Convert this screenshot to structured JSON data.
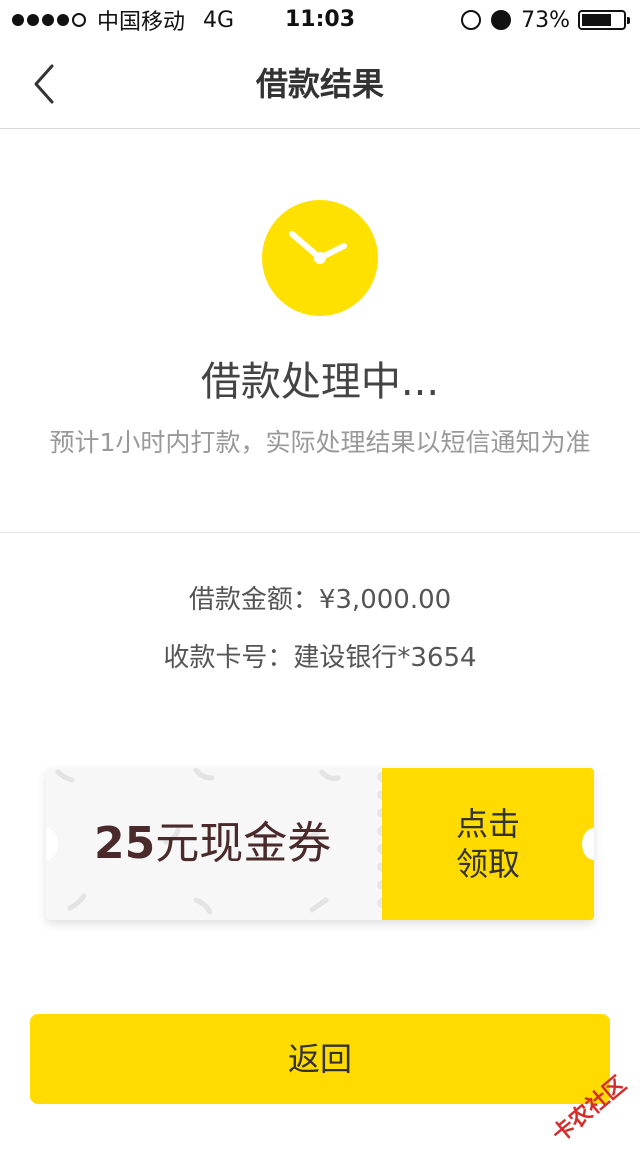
{
  "status_bar": {
    "carrier": "中国移动",
    "network": "4G",
    "time": "11:03",
    "battery": "73%",
    "battery_level": 0.73
  },
  "nav": {
    "title": "借款结果",
    "back_icon": "chevron-left-icon"
  },
  "status": {
    "icon": "clock-icon",
    "icon_color": "#ffe100",
    "title": "借款处理中...",
    "description": "预计1小时内打款，实际处理结果以短信通知为准"
  },
  "loan": {
    "amount_label": "借款金额：",
    "amount_value": "¥3,000.00",
    "card_label": "收款卡号：",
    "card_value": "建设银行*3654"
  },
  "coupon": {
    "amount_number": "25",
    "amount_text": "元现金券",
    "claim_line1": "点击",
    "claim_line2": "领取",
    "accent_color": "#ffdb00"
  },
  "actions": {
    "back_button": "返回"
  },
  "watermark": "卡农社区"
}
